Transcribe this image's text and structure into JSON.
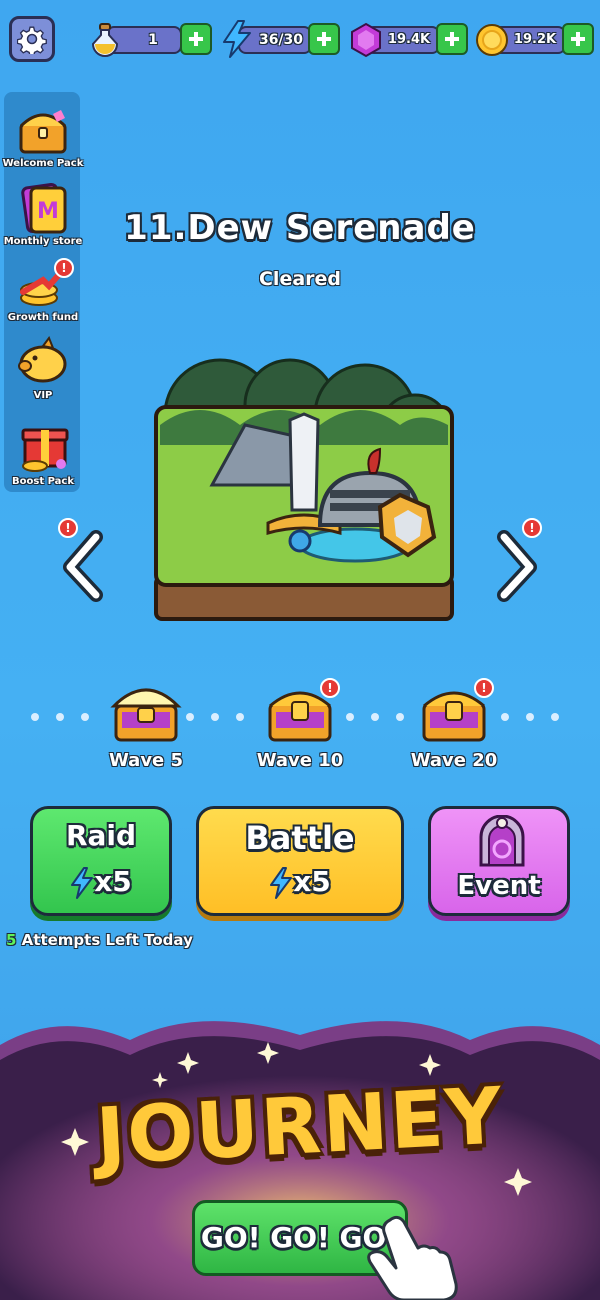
{
  "topbar": {
    "potion": {
      "value": "1",
      "icon": "potion-icon"
    },
    "energy": {
      "value": "36/30",
      "icon": "lightning-icon"
    },
    "gems": {
      "value": "19.4K",
      "icon": "gem-icon"
    },
    "coins": {
      "value": "19.2K",
      "icon": "coin-icon"
    }
  },
  "sidebar": {
    "items": [
      {
        "label": "Welcome Pack",
        "icon": "chest-icon",
        "alert": false
      },
      {
        "label": "Monthly store",
        "icon": "m-card-icon",
        "alert": false
      },
      {
        "label": "Growth fund",
        "icon": "growth-arrow-icon",
        "alert": true
      },
      {
        "label": "VIP",
        "icon": "piggy-bank-icon",
        "alert": false
      },
      {
        "label": "Boost Pack",
        "icon": "gift-box-icon",
        "alert": false
      }
    ]
  },
  "stage": {
    "title": "11.Dew Serenade",
    "status": "Cleared"
  },
  "waves": [
    {
      "label": "Wave 5",
      "opened": true,
      "alert": false
    },
    {
      "label": "Wave 10",
      "opened": false,
      "alert": true
    },
    {
      "label": "Wave 20",
      "opened": false,
      "alert": true
    }
  ],
  "modes": {
    "raid": {
      "title": "Raid",
      "cost": "x5"
    },
    "battle": {
      "title": "Battle",
      "cost": "x5"
    },
    "event": {
      "title": "Event"
    }
  },
  "attempts": {
    "count": "5",
    "text": "Attempts Left Today"
  },
  "journey": {
    "banner": "JOURNEY",
    "button": "GO! GO! GO!"
  },
  "alert_mark": "!",
  "colors": {
    "background": "#45b0f3",
    "raid": "#3ed85a",
    "battle": "#ffc93a",
    "event": "#e27af0",
    "plus": "#37c64a",
    "banner": "#4a2a5a"
  }
}
